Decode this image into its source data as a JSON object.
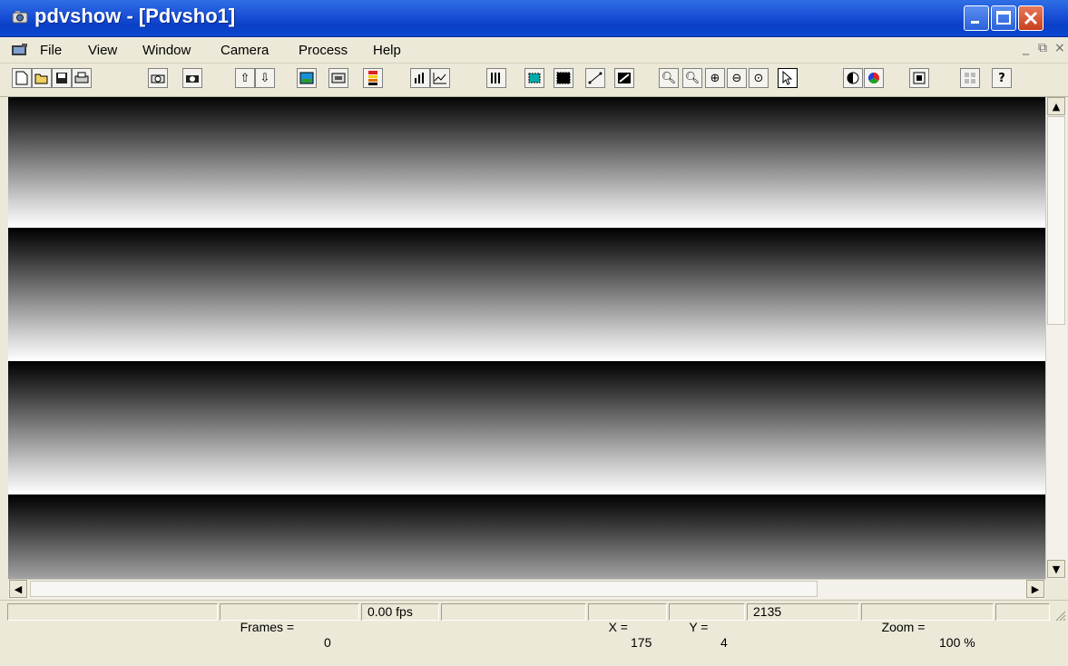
{
  "window": {
    "title": "pdvshow - [Pdvsho1]"
  },
  "menu": {
    "items": [
      "File",
      "View",
      "Window",
      "Camera",
      "Process",
      "Help"
    ],
    "mdi_controls": [
      "_",
      "⧉",
      "×"
    ]
  },
  "toolbar": {
    "buttons": [
      "new-icon",
      "open-icon",
      "save-icon",
      "print-icon",
      "camera-snap-icon",
      "camera-icon",
      "arrow-up-icon",
      "arrow-down-icon",
      "image-icon",
      "filmstrip-icon",
      "color-bars-icon",
      "histogram-icon",
      "line-plot-icon",
      "columns-icon",
      "select-roi-icon",
      "fill-roi-icon",
      "line-profile-icon",
      "diagonal-icon",
      "zoom-icon",
      "zoom-fit-icon",
      "zoom-in-icon",
      "zoom-out-icon",
      "zoom-1to1-icon",
      "pointer-icon",
      "contrast-icon",
      "color-wheel-icon",
      "frame-icon",
      "tile-icon",
      "help-icon"
    ],
    "active": "pointer-icon"
  },
  "status": {
    "frames_label": "Frames =",
    "frames_value": "0",
    "fps": "0.00 fps",
    "x_label": "X =",
    "x_value": "175",
    "y_label": "Y =",
    "y_value": "4",
    "pixel_value": "2135",
    "zoom_label": "Zoom =",
    "zoom_value": "100 %"
  },
  "scroll": {
    "up": "▲",
    "down": "▼",
    "left": "◀",
    "right": "▶"
  },
  "colors": {
    "titlebar": "#0a3fc7",
    "chrome": "#ece9d8",
    "close_button": "#c8401d"
  }
}
